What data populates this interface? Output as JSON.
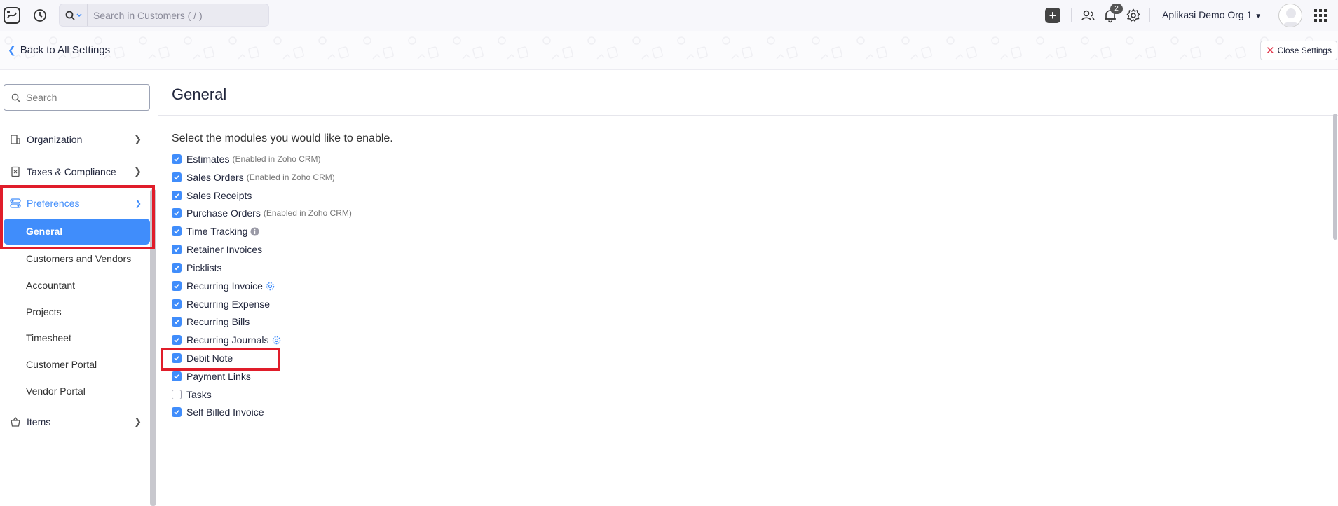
{
  "topbar": {
    "search_placeholder": "Search in Customers ( / )",
    "notification_count": "2",
    "org_name": "Aplikasi Demo Org 1"
  },
  "subheader": {
    "back_label": "Back to All Settings",
    "close_label": "Close Settings"
  },
  "sidebar": {
    "search_placeholder": "Search",
    "items": [
      {
        "label": "Organization",
        "icon": "building-icon"
      },
      {
        "label": "Taxes & Compliance",
        "icon": "tax-doc-icon"
      },
      {
        "label": "Preferences",
        "icon": "toggle-icon"
      }
    ],
    "subitems": [
      "General",
      "Customers and Vendors",
      "Accountant",
      "Projects",
      "Timesheet",
      "Customer Portal",
      "Vendor Portal"
    ],
    "items_last": {
      "label": "Items",
      "icon": "basket-icon"
    }
  },
  "main": {
    "title": "General",
    "prompt": "Select the modules you would like to enable.",
    "modules": [
      {
        "label": "Estimates",
        "note": "(Enabled in Zoho CRM)",
        "checked": true
      },
      {
        "label": "Sales Orders",
        "note": "(Enabled in Zoho CRM)",
        "checked": true
      },
      {
        "label": "Sales Receipts",
        "note": "",
        "checked": true
      },
      {
        "label": "Purchase Orders",
        "note": "(Enabled in Zoho CRM)",
        "checked": true
      },
      {
        "label": "Time Tracking",
        "note": "",
        "checked": true,
        "icon": "info-icon"
      },
      {
        "label": "Retainer Invoices",
        "note": "",
        "checked": true
      },
      {
        "label": "Picklists",
        "note": "",
        "checked": true
      },
      {
        "label": "Recurring Invoice",
        "note": "",
        "checked": true,
        "icon": "gear-icon"
      },
      {
        "label": "Recurring Expense",
        "note": "",
        "checked": true
      },
      {
        "label": "Recurring Bills",
        "note": "",
        "checked": true
      },
      {
        "label": "Recurring Journals",
        "note": "",
        "checked": true,
        "icon": "gear-icon"
      },
      {
        "label": "Debit Note",
        "note": "",
        "checked": true
      },
      {
        "label": "Payment Links",
        "note": "",
        "checked": true
      },
      {
        "label": "Tasks",
        "note": "",
        "checked": false
      },
      {
        "label": "Self Billed Invoice",
        "note": "",
        "checked": true
      }
    ]
  },
  "colors": {
    "accent": "#408dfb",
    "highlight": "#e01d2a"
  }
}
